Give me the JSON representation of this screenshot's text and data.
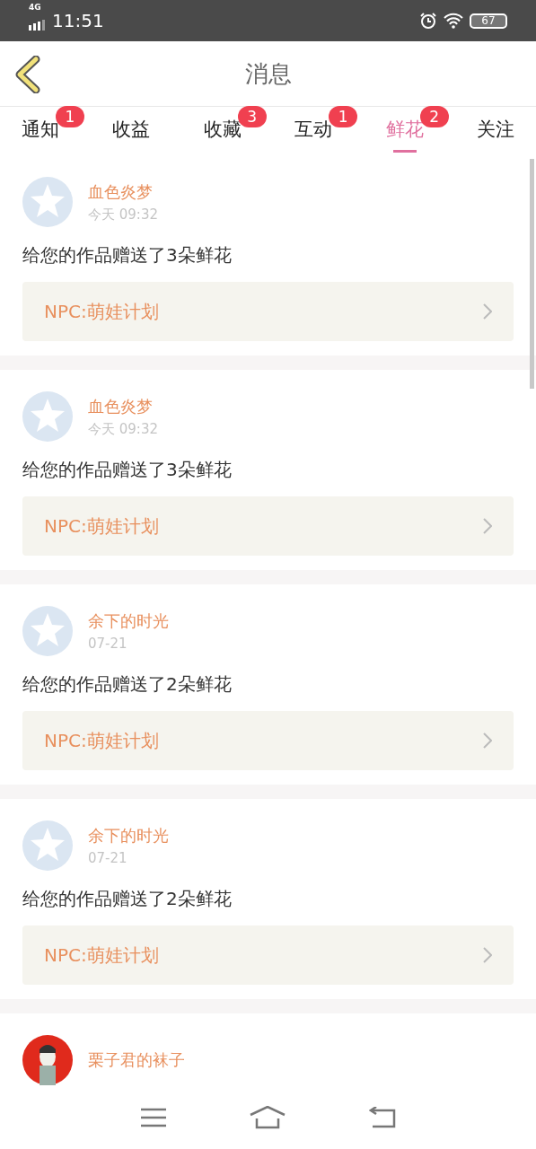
{
  "status_bar": {
    "network": "4G",
    "time": "11:51",
    "battery": "67"
  },
  "header": {
    "title": "消息"
  },
  "tabs": [
    {
      "label": "通知",
      "badge": "1",
      "selected": false
    },
    {
      "label": "收益",
      "selected": false
    },
    {
      "label": "收藏",
      "badge": "3",
      "selected": false
    },
    {
      "label": "互动",
      "badge": "1",
      "selected": false
    },
    {
      "label": "鲜花",
      "badge": "2",
      "selected": true
    },
    {
      "label": "关注",
      "selected": false
    }
  ],
  "messages": [
    {
      "kind": "default",
      "user": "血色炎梦",
      "time": "今天 09:32",
      "text": "给您的作品赠送了3朵鲜花",
      "work": "NPC:萌娃计划"
    },
    {
      "kind": "default",
      "user": "血色炎梦",
      "time": "今天 09:32",
      "text": "给您的作品赠送了3朵鲜花",
      "work": "NPC:萌娃计划"
    },
    {
      "kind": "default",
      "user": "余下的时光",
      "time": "07-21",
      "text": "给您的作品赠送了2朵鲜花",
      "work": "NPC:萌娃计划"
    },
    {
      "kind": "default",
      "user": "余下的时光",
      "time": "07-21",
      "text": "给您的作品赠送了2朵鲜花",
      "work": "NPC:萌娃计划"
    },
    {
      "kind": "picture",
      "user": "栗子君的袜子"
    }
  ]
}
